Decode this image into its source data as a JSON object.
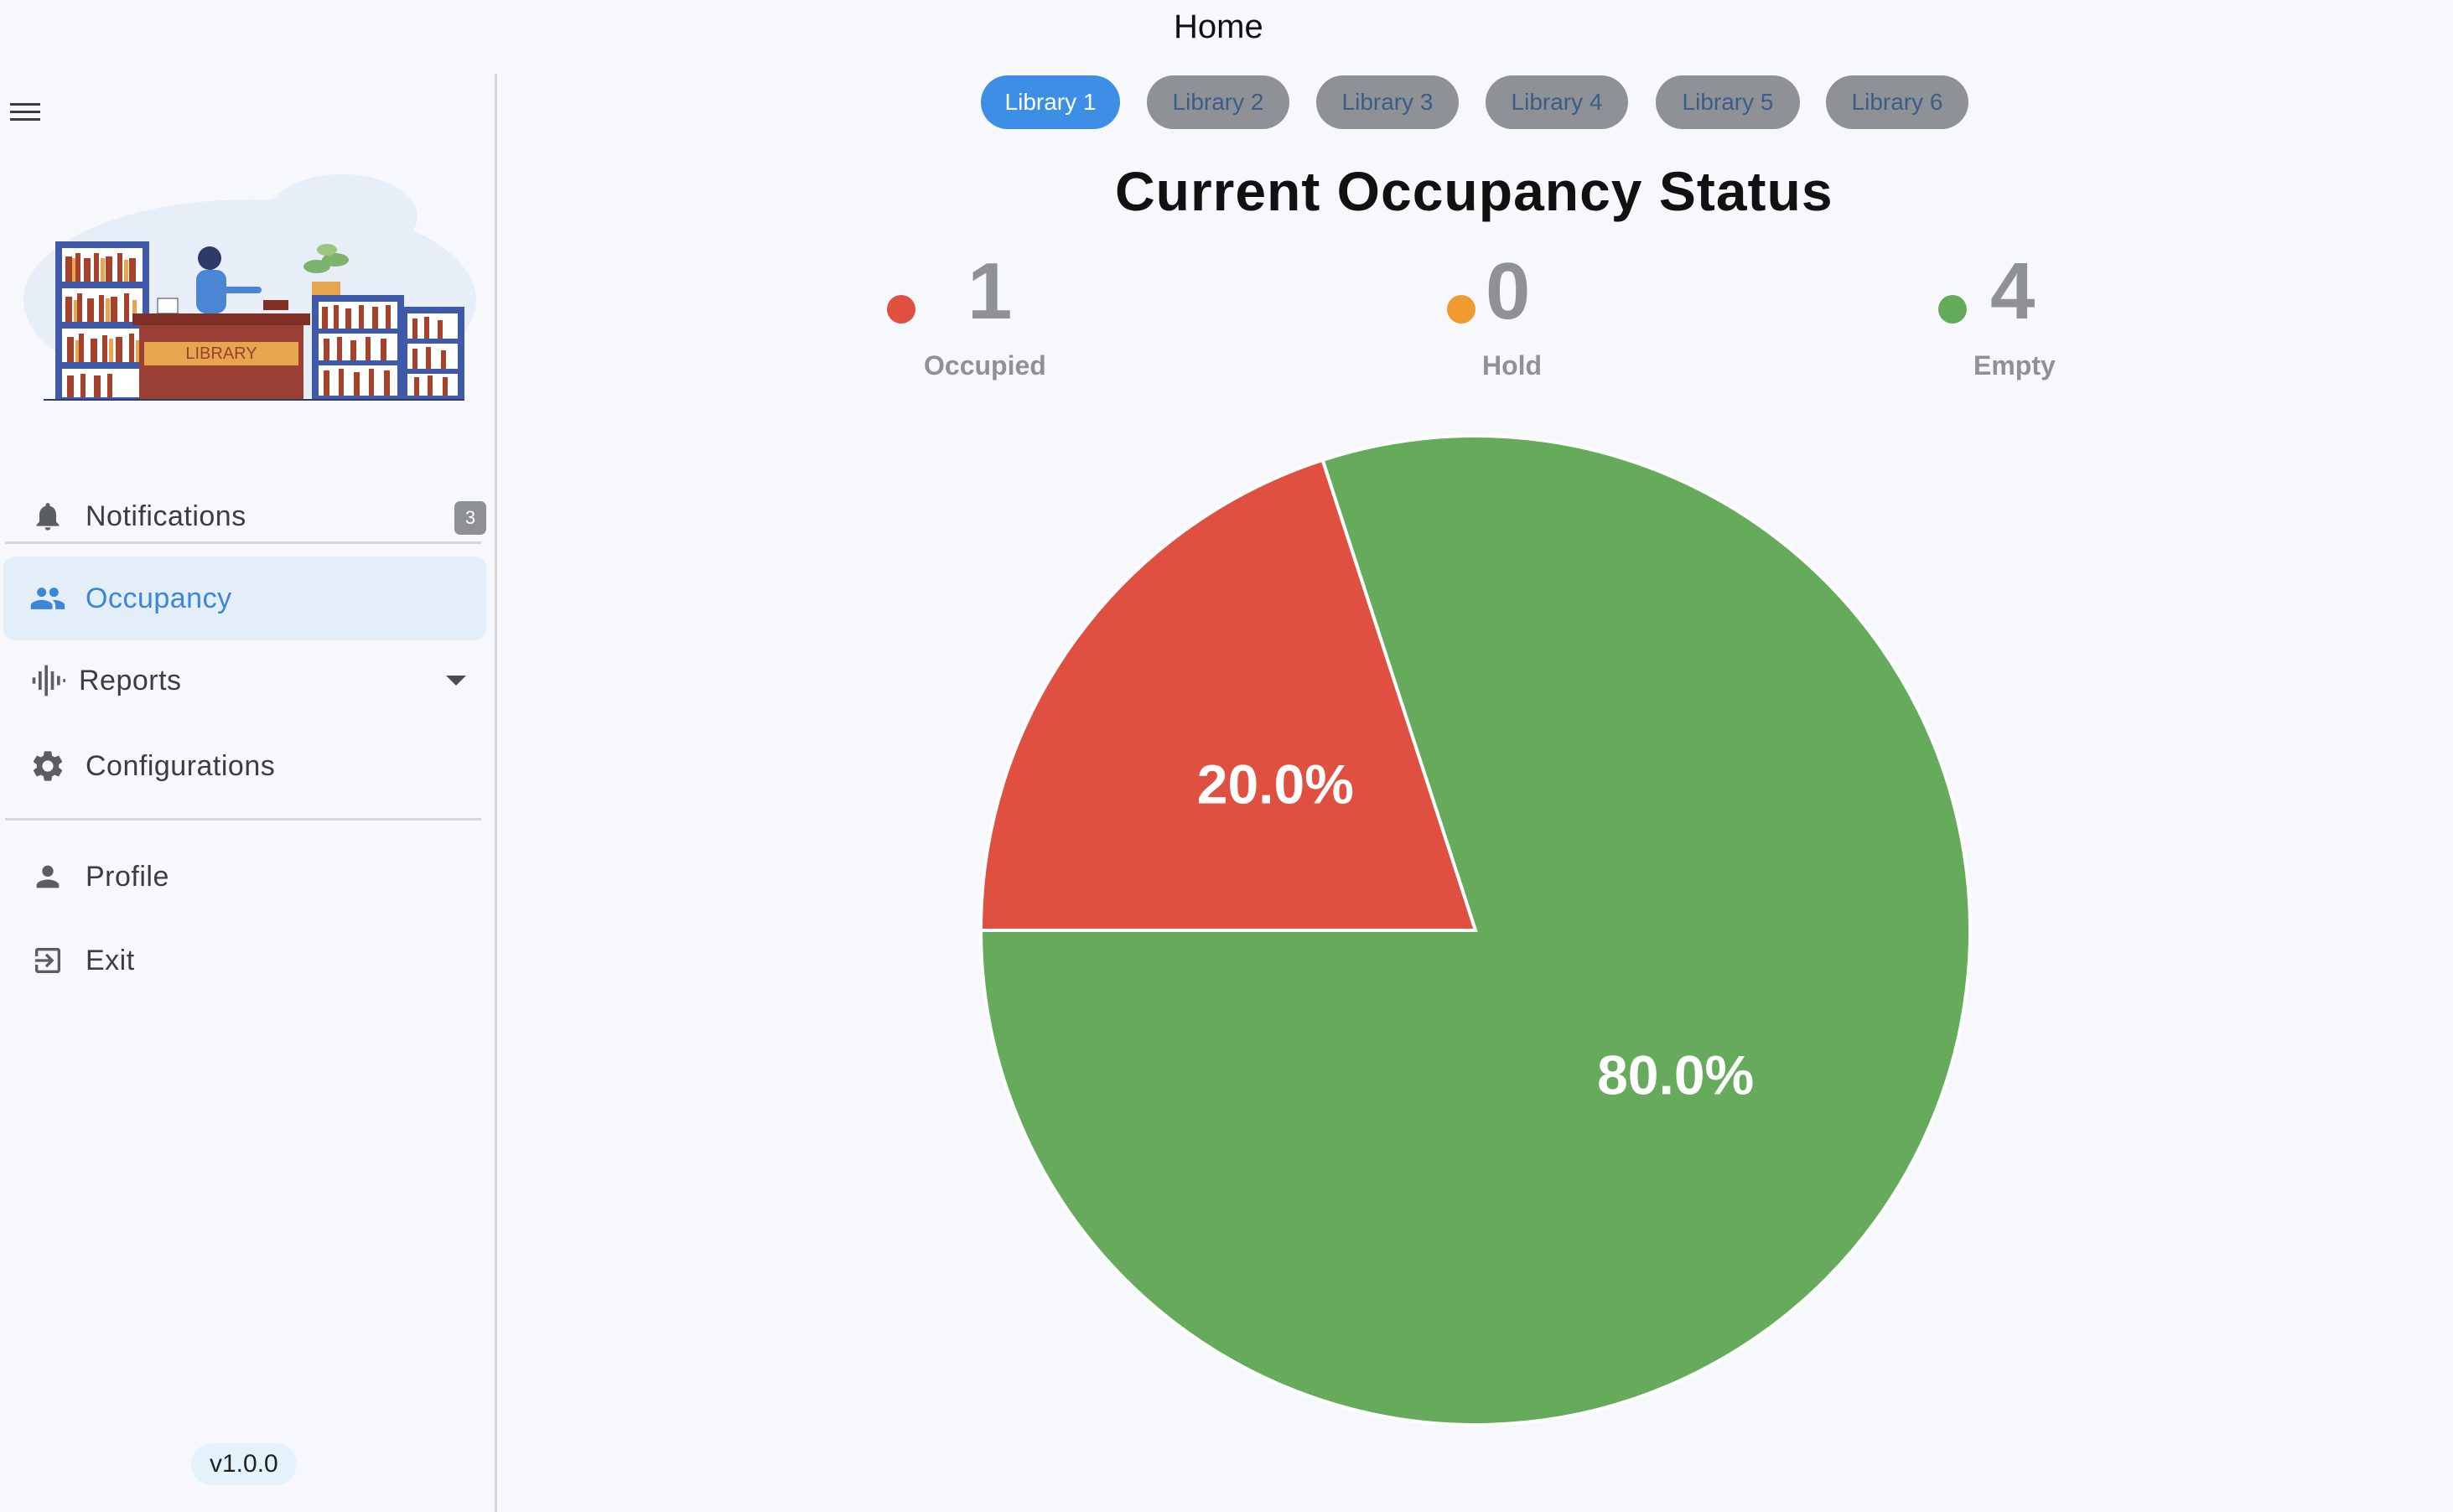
{
  "app": {
    "title": "Home"
  },
  "sidebar": {
    "nav": {
      "notifications": {
        "label": "Notifications",
        "badge": "3",
        "icon": "bell-icon"
      },
      "occupancy": {
        "label": "Occupancy",
        "icon": "people-icon",
        "active": true
      },
      "reports": {
        "label": "Reports",
        "icon": "waveform-icon"
      },
      "configurations": {
        "label": "Configurations",
        "icon": "gear-icon"
      },
      "profile": {
        "label": "Profile",
        "icon": "person-icon"
      },
      "exit": {
        "label": "Exit",
        "icon": "exit-icon"
      }
    },
    "illustration": {
      "sign_text": "LIBRARY"
    },
    "version": "v1.0.0"
  },
  "tabs": [
    "Library 1",
    "Library 2",
    "Library 3",
    "Library 4",
    "Library 5",
    "Library 6"
  ],
  "active_tab": "Library 1",
  "status": {
    "title": "Current Occupancy Status",
    "counts": [
      {
        "label": "Occupied",
        "value": "1",
        "color": "#e05040"
      },
      {
        "label": "Hold",
        "value": "0",
        "color": "#f19a30"
      },
      {
        "label": "Empty",
        "value": "4",
        "color": "#63ab5b"
      }
    ]
  },
  "chart_data": {
    "type": "pie",
    "slices": [
      {
        "label": "Occupied",
        "value": 1,
        "percent_label": "20.0%",
        "color": "#e05040"
      },
      {
        "label": "Hold",
        "value": 0,
        "percent_label": "",
        "color": "#f19a30"
      },
      {
        "label": "Empty",
        "value": 4,
        "percent_label": "80.0%",
        "color": "#66ab5c"
      }
    ]
  },
  "colors": {
    "accent": "#3d8fe6",
    "active_nav_bg": "#e4eef9",
    "tab_inactive": "#8e9196"
  }
}
